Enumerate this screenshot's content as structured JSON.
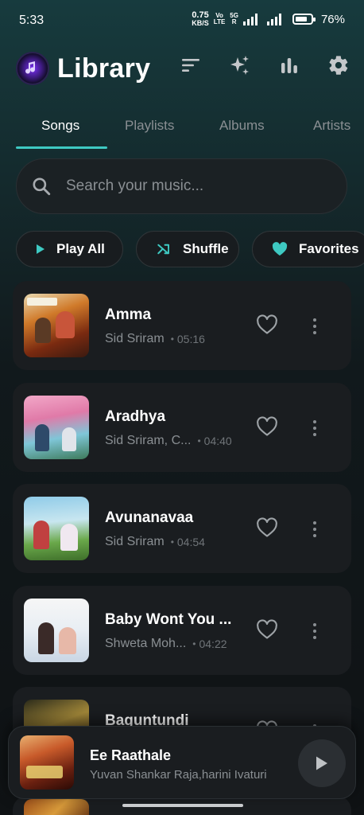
{
  "status_bar": {
    "time": "5:33",
    "net_speed_value": "0.75",
    "net_speed_unit": "KB/S",
    "volte_top": "Vo",
    "volte_bottom": "LTE",
    "gen_top": "5G",
    "gen_bottom": "R",
    "battery_pct": "76%",
    "battery_level": 0.76
  },
  "header": {
    "title": "Library",
    "icons": [
      "sort-icon",
      "sparkle-icon",
      "equalizer-icon",
      "gear-icon"
    ]
  },
  "tabs": [
    {
      "label": "Songs",
      "active": true
    },
    {
      "label": "Playlists",
      "active": false
    },
    {
      "label": "Albums",
      "active": false
    },
    {
      "label": "Artists",
      "active": false
    }
  ],
  "search": {
    "placeholder": "Search your music..."
  },
  "chips": [
    {
      "label": "Play All",
      "icon": "play-icon"
    },
    {
      "label": "Shuffle",
      "icon": "shuffle-icon"
    },
    {
      "label": "Favorites",
      "icon": "heart-icon"
    }
  ],
  "songs": [
    {
      "title": "Amma",
      "artist": "Sid Sriram",
      "duration": "05:16"
    },
    {
      "title": "Aradhya",
      "artist": "Sid Sriram, C...",
      "duration": "04:40"
    },
    {
      "title": "Avunanavaa",
      "artist": "Sid Sriram",
      "duration": "04:54"
    },
    {
      "title": "Baby Wont You ...",
      "artist": "Shweta Moh...",
      "duration": "04:22"
    },
    {
      "title": "Baguntundi",
      "artist": "",
      "duration": ""
    }
  ],
  "now_playing": {
    "title": "Ee Raathale",
    "artist": "Yuvan Shankar Raja,harini Ivaturi"
  },
  "colors": {
    "accent": "#3ec9c2",
    "background": "#11191c",
    "card": "#1a1d20",
    "muted_text": "#8a8f93"
  }
}
